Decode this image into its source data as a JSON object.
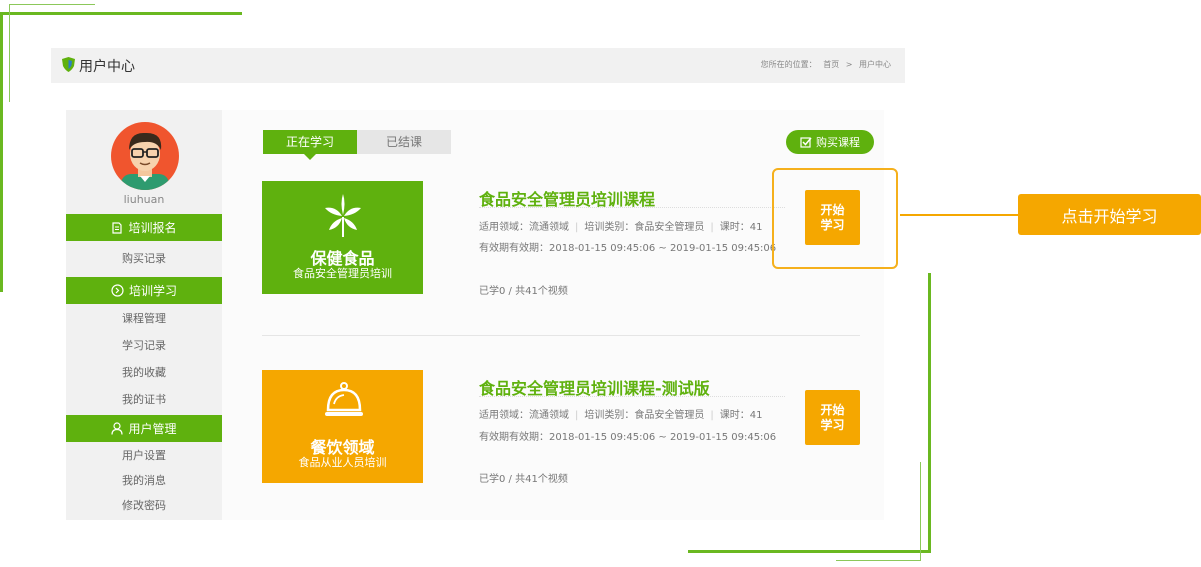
{
  "header": {
    "title": "用户中心",
    "breadcrumb": {
      "prefix": "您所在的位置：",
      "home": "首页",
      "sep": ">",
      "current": "用户中心"
    }
  },
  "user": {
    "name": "liuhuan"
  },
  "sidebar": {
    "sections": [
      {
        "label": "培训报名",
        "icon": "document-icon",
        "items": [
          "购买记录"
        ]
      },
      {
        "label": "培训学习",
        "icon": "circle-arrow-icon",
        "items": [
          "课程管理",
          "学习记录",
          "我的收藏",
          "我的证书"
        ]
      },
      {
        "label": "用户管理",
        "icon": "user-icon",
        "items": [
          "用户设置",
          "我的消息",
          "修改密码"
        ]
      }
    ]
  },
  "tabs": [
    {
      "label": "正在学习",
      "active": true
    },
    {
      "label": "已结课",
      "active": false
    }
  ],
  "buy_button": "购买课程",
  "courses": [
    {
      "cover_title": "保健食品",
      "cover_subtitle": "食品安全管理员培训",
      "cover_color": "#5fb10e",
      "cover_icon": "leaf-icon",
      "title": "食品安全管理员培训课程",
      "field": "适用领域：流通领域",
      "category": "培训类别：食品安全管理员",
      "hours": "课时：41",
      "validity": "有效期有效期：2018-01-15 09:45:06 ~ 2019-01-15 09:45:06",
      "progress": "已学0 / 共41个视频",
      "start_label": "开始\n学习"
    },
    {
      "cover_title": "餐饮领域",
      "cover_subtitle": "食品从业人员培训",
      "cover_color": "#f5a700",
      "cover_icon": "cloche-icon",
      "title": "食品安全管理员培训课程-测试版",
      "field": "适用领域：流通领域",
      "category": "培训类别：食品安全管理员",
      "hours": "课时：41",
      "validity": "有效期有效期：2018-01-15 09:45:06 ~ 2019-01-15 09:45:06",
      "progress": "已学0 / 共41个视频",
      "start_label": "开始\n学习"
    }
  ],
  "callout": "点击开始学习",
  "colors": {
    "green": "#5fb10e",
    "orange": "#f5a700",
    "highlight": "#f5b01c"
  }
}
